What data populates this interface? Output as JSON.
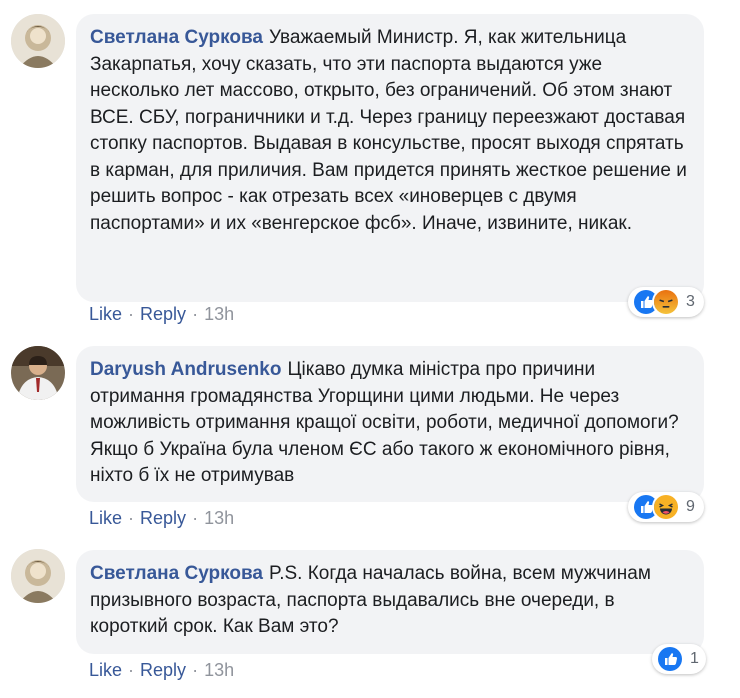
{
  "comments": [
    {
      "author": "Светлана Суркова",
      "text": "Уважаемый Министр. Я, как жительница Закарпатья, хочу сказать, что эти паспорта выдаются уже несколько лет массово, открыто, без ограничений. Об этом знают ВСЕ. СБУ, пограничники и т.д. Через границу переезжают доставая стопку паспортов. Выдавая в консульстве, просят выходя спрятать в карман, для приличия. Вам придется принять жесткое решение и решить вопрос - как отрезать всех «иноверцев с двумя паспортами» и их «венгерское фсб». Иначе, извините, никак.",
      "like": "Like",
      "reply": "Reply",
      "time": "13h",
      "reaction_count": "3",
      "reactions": [
        "like-icon",
        "angry-icon"
      ]
    },
    {
      "author": "Daryush Andrusenko",
      "text": "Цікаво думка міністра про причини отримання громадянства Угорщини цими людьми. Не через можливість отримання кращої освіти, роботи, медичної допомоги? Якщо б Україна була членом ЄС або такого ж економічного рівня, ніхто б їх не отримував",
      "like": "Like",
      "reply": "Reply",
      "time": "13h",
      "reaction_count": "9",
      "reactions": [
        "like-icon",
        "haha-icon"
      ]
    },
    {
      "author": "Светлана Суркова",
      "text": "P.S. Когда началась война, всем мужчинам призывного возраста, паспорта выдавались вне очереди, в короткий срок. Как Вам это?",
      "like": "Like",
      "reply": "Reply",
      "time": "13h",
      "reaction_count": "1",
      "reactions": [
        "like-icon"
      ]
    }
  ],
  "colors": {
    "author": "#385898",
    "bubble": "#f2f3f5",
    "meta": "#90949c",
    "like_reaction": "#1877f2",
    "angry_reaction": "#e9710f",
    "haha_reaction": "#f7b125"
  }
}
